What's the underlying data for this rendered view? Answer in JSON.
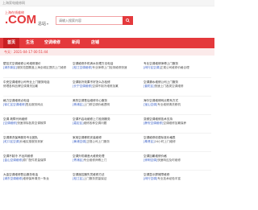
{
  "topbar": {
    "text": "上海家电维修网"
  },
  "header": {
    "logo_small": "上海在线维修",
    "logo_main": ".COM",
    "city": "总站",
    "search_placeholder": "请输入搜索内容"
  },
  "nav": {
    "items": [
      "首页",
      "生活",
      "空调维修",
      "新闻",
      "店铺"
    ]
  },
  "date_bar": "今天：2021-04-17 00:51:44",
  "cards": [
    {
      "l1": "壁挂式空调维修公司维修报价",
      "l2_hl": "[浦东新区]",
      "l2": "服务范围覆盖上海全城区提供上门维修"
    },
    {
      "l1": "空调维修外机滴水处理方法电话",
      "l2_hl": "[松江空调维修]",
      "l2": "专业师傅上门检测维修快速"
    },
    {
      "l1": "专业空调维修师傅上门服务",
      "l2_hl": "[闵行区空调]",
      "l2": "正规公司维修价格合理"
    },
    {
      "l1": "中央空调维修公司专业上门服务电话",
      "l2_hl": "",
      "l2": "修理各种品牌空调清洗加氟"
    },
    {
      "l1": "空调制冷效果不好怎么办检修",
      "l2_hl": "[长宁空调维修]",
      "l2": "空调不制冷维修加氟"
    },
    {
      "l1": "空调漏水维修公司上门服务",
      "l2_hl": "[普陀区]",
      "l2": "快速上门各类空调维修"
    },
    {
      "l1": "格力空调维修点电话",
      "l2_hl": "[徐汇区空调维修]",
      "l2": "售后服务网点"
    },
    {
      "l1": "美的空调售后维修中心服务",
      "l2_hl": "[杨浦区]",
      "l2": "上门修空调价格透明"
    },
    {
      "l1": "海尔空调维修网点联系方式",
      "l2_hl": "[宝山空调]",
      "l2": "专业维修清洗移机"
    },
    {
      "l1": "空调 故障代码维修",
      "l2_hl": "[空调维修]",
      "l2": "快速排除各类空调故障"
    },
    {
      "l1": "空调不启动维修上门检测服务",
      "l2_hl": "[嘉定区]",
      "l2": "维修各种空调问题"
    },
    {
      "l1": "变频空调维修技术支持",
      "l2_hl": "[静安空调维修]",
      "l2": "空调维修加氟保养"
    },
    {
      "l1": "空调清洗保养服务专业团队",
      "l2_hl": "[虹口区空调]",
      "l2": "价格实惠服务到家"
    },
    {
      "l1": "家用空调移机安装维修",
      "l2_hl": "[黄浦空调]",
      "l2": "正规公司上门服务"
    },
    {
      "l1": "空调维修收费标准价格表",
      "l2_hl": "[奉贤区]",
      "l2": "24小时上门维修"
    },
    {
      "l1": "空调不制冷 不出风维修",
      "l2_hl": "[金山空调维修]",
      "l2": "原厂配件质量保障"
    },
    {
      "l1": "空调外机噪音大维修处理",
      "l2_hl": "[青浦区]",
      "l2": "专业维修师傅上门"
    },
    {
      "l1": "空调加氟维修价格",
      "l2_hl": "[崇明空调]",
      "l2": "快速响应及时维修"
    },
    {
      "l1": "大金空调维修售后服务电话",
      "l2_hl": "[浦东空调维修]",
      "l2": "维修保养清洗一条龙"
    },
    {
      "l1": "空调遥控器失灵维修方法",
      "l2_hl": "[松江区]",
      "l2": "上门服务质量保证"
    },
    {
      "l1": "空调显示屏故障维修",
      "l2_hl": "[闵行空调]",
      "l2": "专业技术经验丰富"
    }
  ]
}
